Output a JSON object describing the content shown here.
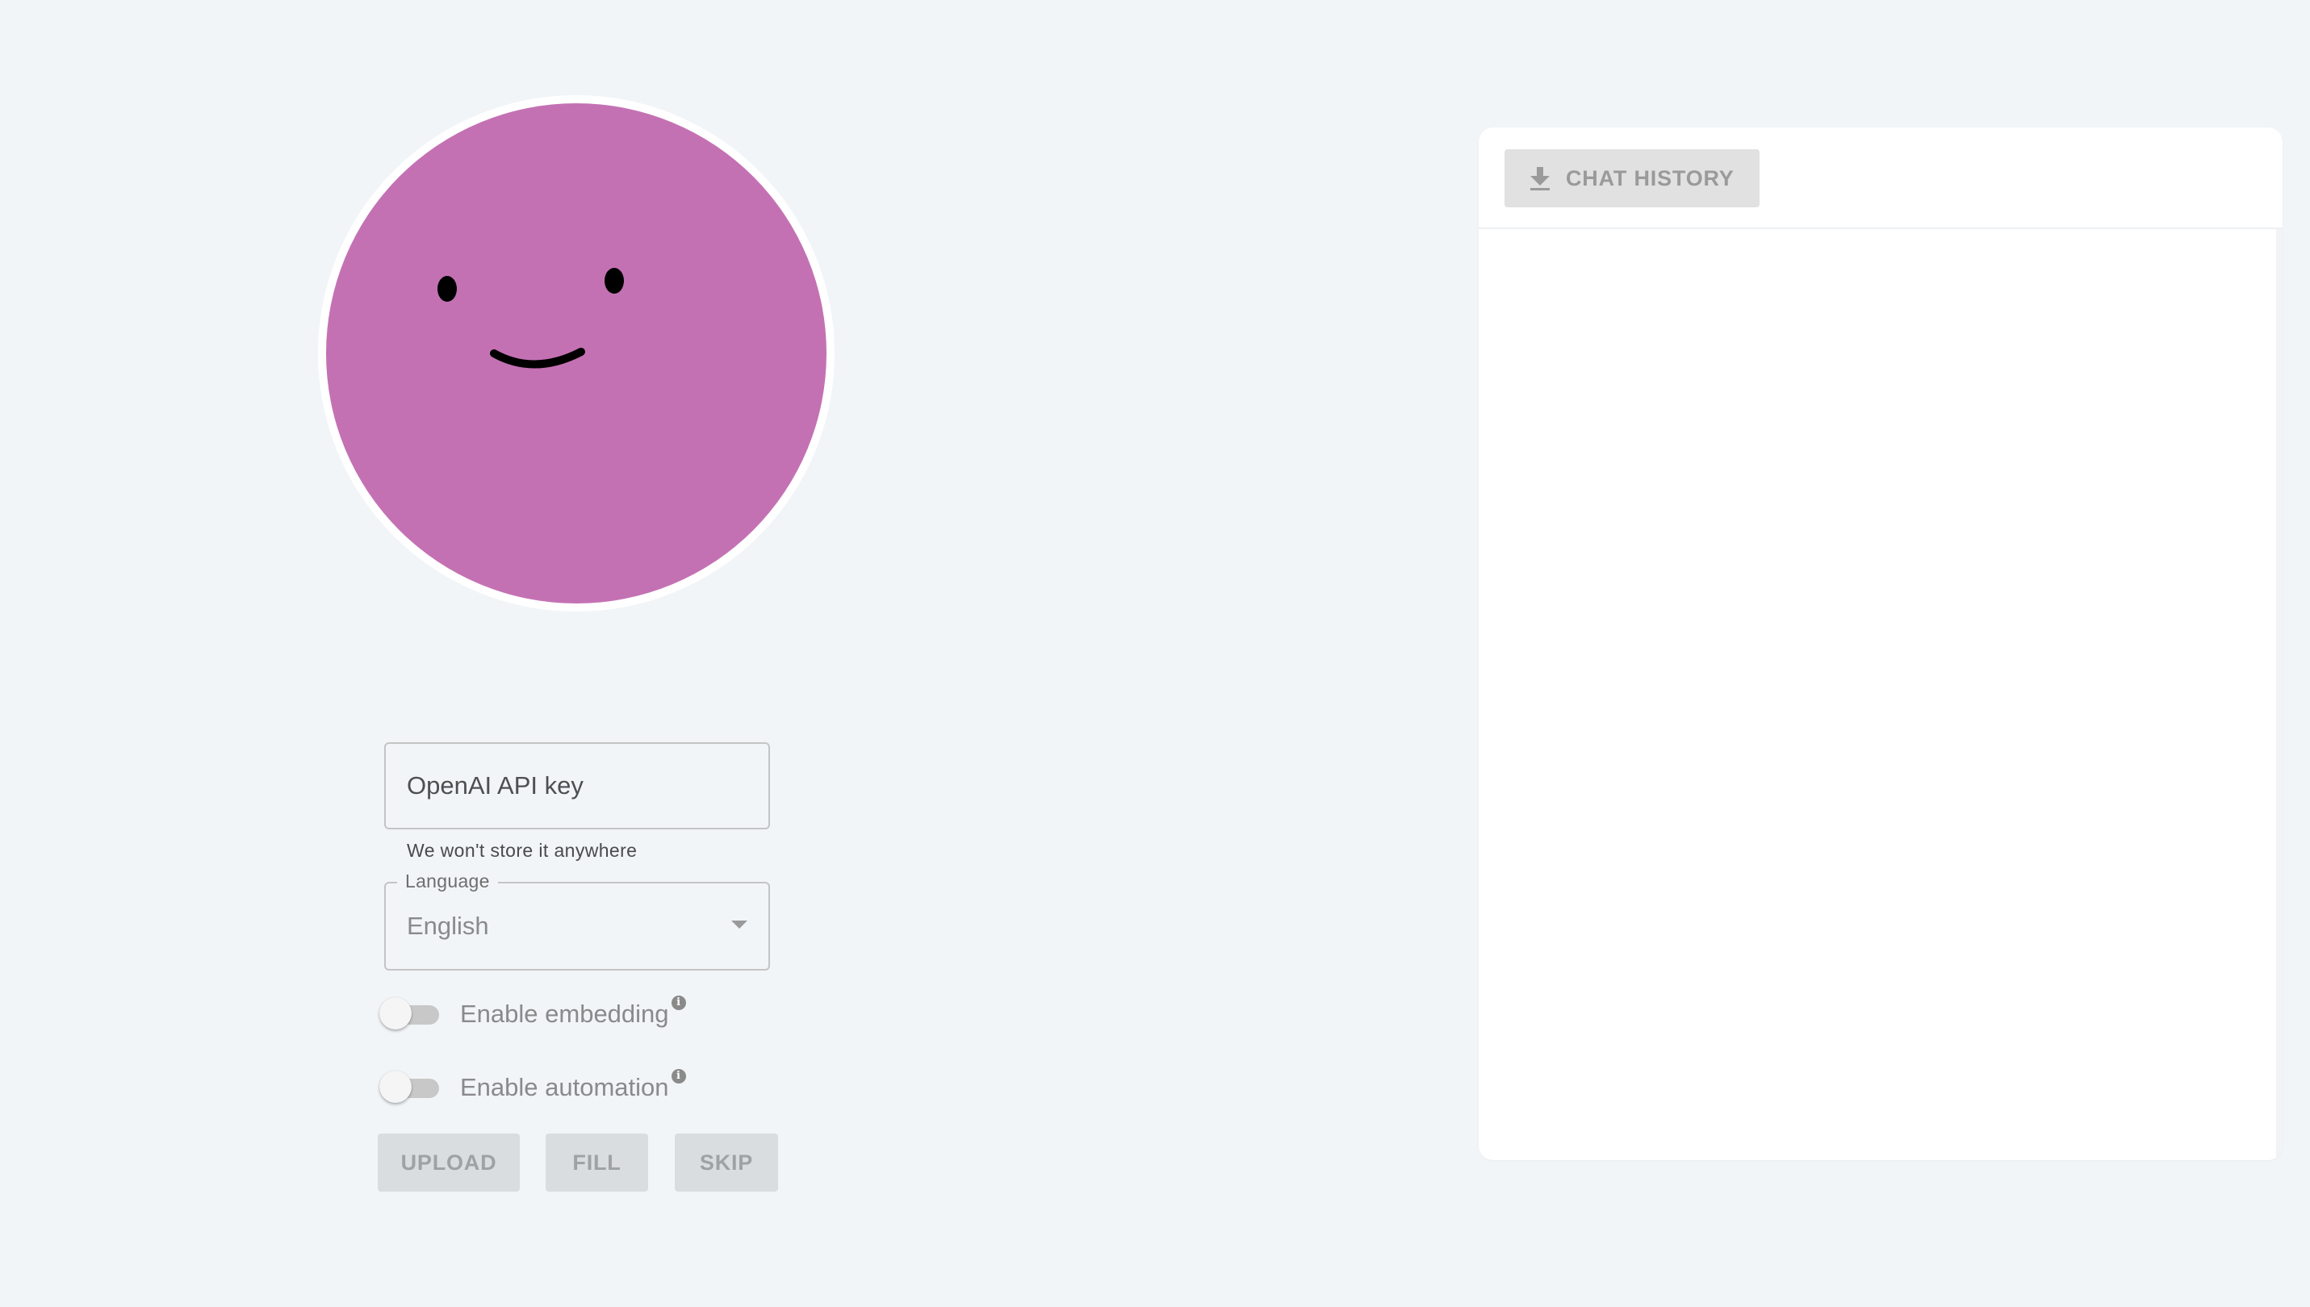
{
  "avatar": {
    "face_color": "#c471b4",
    "ring_color": "#ffffff"
  },
  "form": {
    "api_key": {
      "placeholder": "OpenAI API key",
      "value": "",
      "helper": "We won't store it anywhere"
    },
    "language": {
      "label": "Language",
      "selected": "English"
    },
    "toggles": [
      {
        "label": "Enable embedding",
        "checked": false
      },
      {
        "label": "Enable automation",
        "checked": false
      }
    ],
    "buttons": {
      "upload": "UPLOAD",
      "fill": "FILL",
      "skip": "SKIP"
    }
  },
  "chat": {
    "history_button": "CHAT HISTORY",
    "history_icon": "download-icon"
  },
  "colors": {
    "background": "#f1f5f8",
    "button_disabled_bg": "#dadddf",
    "button_disabled_text": "#9fa2a5"
  }
}
